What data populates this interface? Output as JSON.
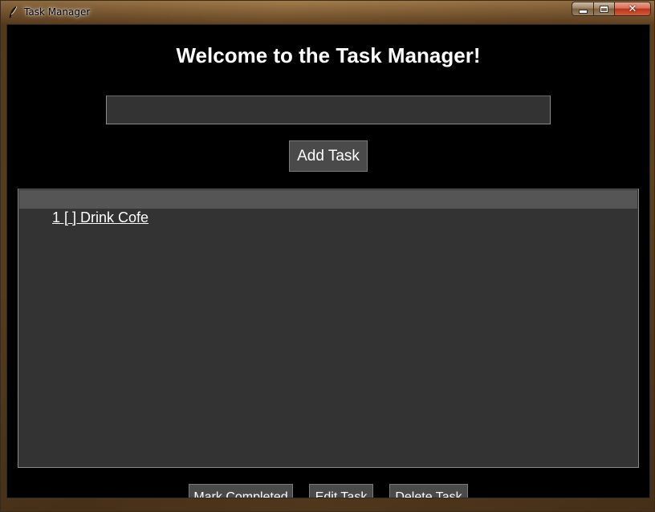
{
  "window": {
    "title": "Task Manager",
    "icon": "feather-icon",
    "controls": {
      "minimize": "minimize-icon",
      "maximize": "maximize-icon",
      "close_glyph": "✕"
    }
  },
  "main": {
    "heading": "Welcome to the Task Manager!",
    "task_input": {
      "value": "",
      "placeholder": ""
    },
    "add_button_label": "Add Task",
    "tasks": [
      {
        "label": "1 [ ] Drink Cofe",
        "selected": true
      }
    ],
    "actions": {
      "mark_completed_label": "Mark Completed",
      "edit_label": "Edit Task",
      "delete_label": "Delete Task"
    }
  },
  "colors": {
    "background": "#000000",
    "panel": "#333333",
    "button": "#4a4a4a",
    "selection": "#555555",
    "text": "#ffffff"
  }
}
